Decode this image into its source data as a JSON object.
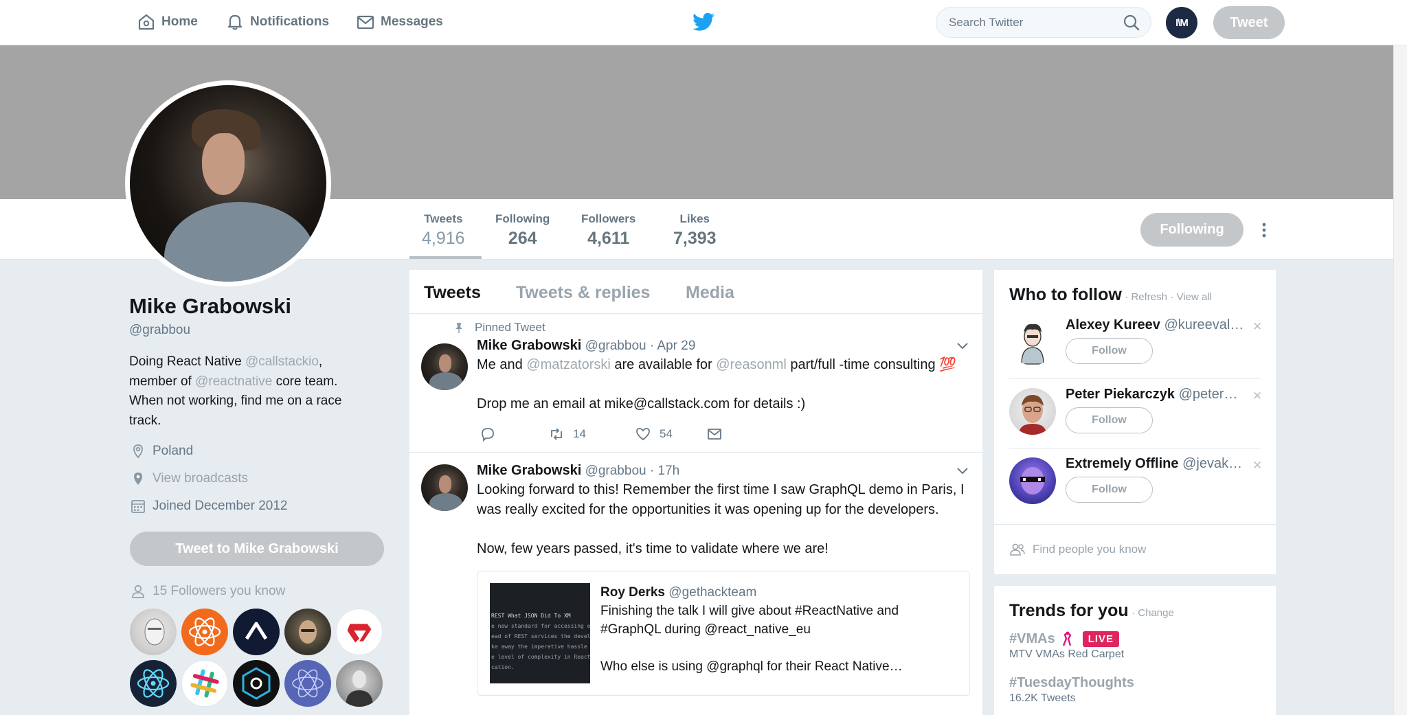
{
  "topbar": {
    "home": "Home",
    "notifications": "Notifications",
    "messages": "Messages",
    "search_placeholder": "Search Twitter",
    "avatar_initials": "I\\M",
    "tweet_button": "Tweet"
  },
  "profile": {
    "name": "Mike Grabowski",
    "handle": "@grabbou",
    "bio": {
      "p1": "Doing React Native ",
      "m1": "@callstackio",
      "p2": ", member of ",
      "m2": "@reactnative",
      "p3": " core team. When not working, find me on a race track."
    },
    "location": "Poland",
    "broadcasts": "View broadcasts",
    "joined": "Joined December 2012",
    "tweet_to": "Tweet to Mike Grabowski",
    "followers_you_know": "15 Followers you know"
  },
  "stats": [
    {
      "label": "Tweets",
      "value": "4,916"
    },
    {
      "label": "Following",
      "value": "264"
    },
    {
      "label": "Followers",
      "value": "4,611"
    },
    {
      "label": "Likes",
      "value": "7,393"
    }
  ],
  "following_button": "Following",
  "tabs": [
    "Tweets",
    "Tweets & replies",
    "Media"
  ],
  "tweets": [
    {
      "pinned_label": "Pinned Tweet",
      "name": "Mike Grabowski",
      "handle": "@grabbou",
      "time": "· Apr 29",
      "text_a": "Me and ",
      "m1": "@matzatorski",
      "text_b": " are available for ",
      "m2": "@reasonml",
      "text_c": " part/full -time consulting",
      "emoji": "💯",
      "text_d": "Drop me an email at mike@callstack.com for details :)",
      "retweets": "14",
      "likes": "54"
    },
    {
      "name": "Mike Grabowski",
      "handle": "@grabbou",
      "time": "· 17h",
      "text_a": "Looking forward to this! Remember the first time I saw GraphQL demo in Paris, I was really excited for the opportunities it was opening up for the developers.",
      "text_b": "Now, few years passed, it's time to validate where we are!",
      "card": {
        "name": "Roy Derks",
        "handle": "@gethackteam",
        "line1": "Finishing the talk I will give about #ReactNative and #GraphQL during @react_native_eu",
        "line2": "Who else is using @graphql for their React Native…",
        "image_text": "REST What JSON Did To XM"
      }
    }
  ],
  "who_to_follow": {
    "title": "Who to follow",
    "refresh": "· Refresh",
    "view_all": "· View all",
    "follow_label": "Follow",
    "users": [
      {
        "name": "Alexey Kureev",
        "handle": "@kureeval…"
      },
      {
        "name": "Peter Piekarczyk",
        "handle": "@peter…"
      },
      {
        "name": "Extremely Offline",
        "handle": "@jevak…"
      }
    ],
    "find_people": "Find people you know"
  },
  "trends": {
    "title": "Trends for you",
    "change": "· Change",
    "live_badge": "LIVE",
    "items": [
      {
        "tag": "#VMAs",
        "sub": "MTV VMAs Red Carpet"
      },
      {
        "tag": "#TuesdayThoughts",
        "sub": "16.2K Tweets"
      }
    ]
  },
  "colors": {
    "brand": "#1da1f2",
    "live": "#e0245e"
  }
}
